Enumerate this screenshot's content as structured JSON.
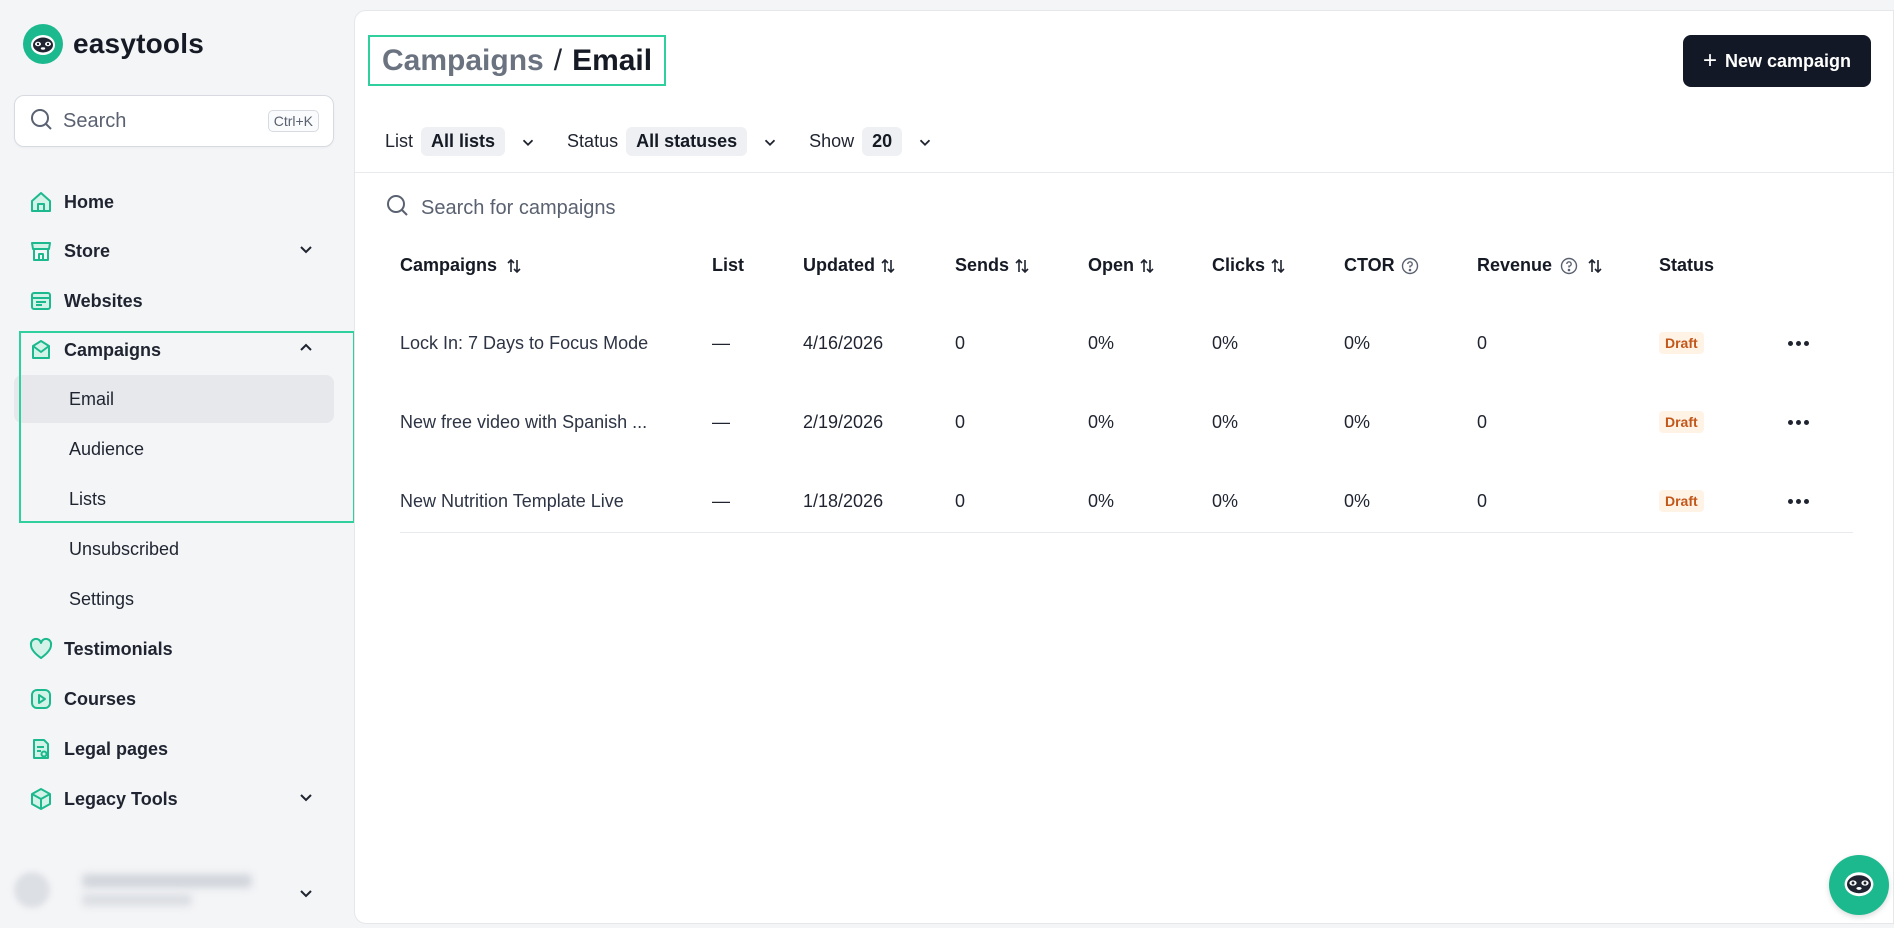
{
  "brand": {
    "name": "easytools"
  },
  "search": {
    "label": "Search",
    "shortcut": "Ctrl+K"
  },
  "sidebar": {
    "items": [
      {
        "label": "Home",
        "icon": "home-icon"
      },
      {
        "label": "Store",
        "icon": "store-icon",
        "expandable": true
      },
      {
        "label": "Websites",
        "icon": "websites-icon"
      },
      {
        "label": "Campaigns",
        "icon": "campaigns-icon",
        "expanded": true
      },
      {
        "label": "Testimonials",
        "icon": "heart-icon"
      },
      {
        "label": "Courses",
        "icon": "play-icon"
      },
      {
        "label": "Legal pages",
        "icon": "legal-icon"
      },
      {
        "label": "Legacy Tools",
        "icon": "box-icon",
        "expandable": true
      }
    ],
    "campaign_subitems": [
      {
        "label": "Email",
        "active": true
      },
      {
        "label": "Audience"
      },
      {
        "label": "Lists"
      },
      {
        "label": "Unsubscribed"
      },
      {
        "label": "Settings"
      }
    ]
  },
  "header": {
    "breadcrumb_parent": "Campaigns",
    "breadcrumb_sep": "/",
    "breadcrumb_current": "Email",
    "new_button": "New campaign"
  },
  "filters": {
    "list_label": "List",
    "list_value": "All lists",
    "status_label": "Status",
    "status_value": "All statuses",
    "show_label": "Show",
    "show_value": "20"
  },
  "table_search": {
    "placeholder": "Search for campaigns"
  },
  "table": {
    "columns": [
      "Campaigns",
      "List",
      "Updated",
      "Sends",
      "Open",
      "Clicks",
      "CTOR",
      "Revenue",
      "Status"
    ],
    "rows": [
      {
        "name": "Lock In: 7 Days to Focus Mode",
        "list": "—",
        "updated": "4/16/2026",
        "sends": "0",
        "open": "0%",
        "clicks": "0%",
        "ctor": "0%",
        "revenue": "0",
        "status": "Draft"
      },
      {
        "name": "New free video with Spanish ...",
        "list": "—",
        "updated": "2/19/2026",
        "sends": "0",
        "open": "0%",
        "clicks": "0%",
        "ctor": "0%",
        "revenue": "0",
        "status": "Draft"
      },
      {
        "name": "New Nutrition Template Live",
        "list": "—",
        "updated": "1/18/2026",
        "sends": "0",
        "open": "0%",
        "clicks": "0%",
        "ctor": "0%",
        "revenue": "0",
        "status": "Draft"
      }
    ]
  },
  "colors": {
    "accent": "#1db98e",
    "highlight": "#2fcf9e",
    "primary_button": "#121826",
    "draft_badge_text": "#c2571a",
    "draft_badge_bg": "#fff3e6"
  }
}
